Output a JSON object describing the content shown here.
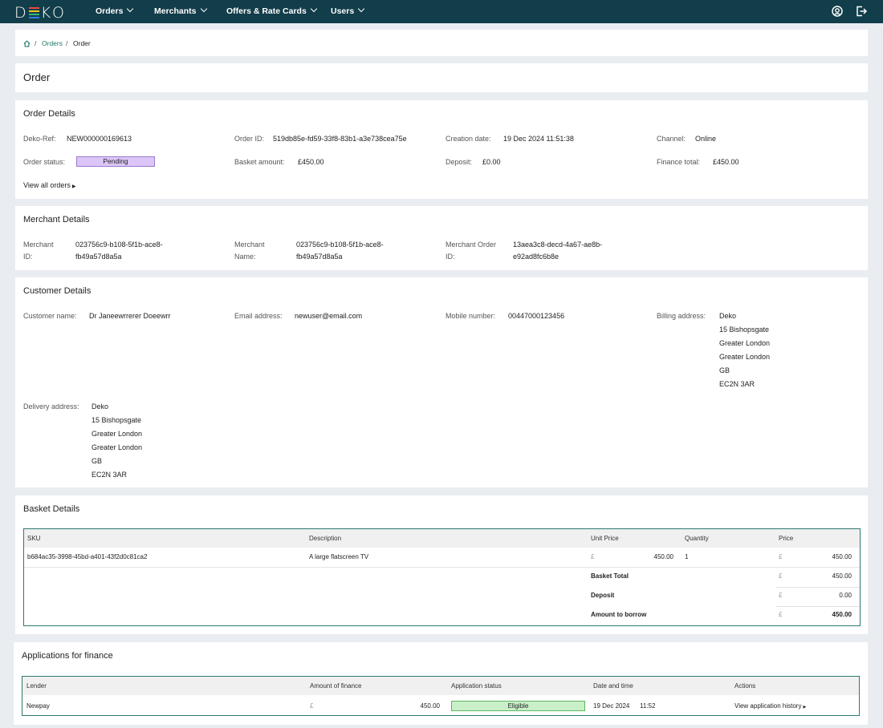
{
  "topbar": {
    "logo": "DEKO",
    "nav": [
      "Orders",
      "Merchants",
      "Offers & Rate Cards",
      "Users"
    ]
  },
  "breadcrumb": {
    "orders": "Orders",
    "current": "Order"
  },
  "page_title": "Order",
  "order_details": {
    "title": "Order Details",
    "deko_ref_label": "Deko-Ref:",
    "deko_ref": "NEW000000169613",
    "order_id_label": "Order ID:",
    "order_id": "519db85e-fd59-33f8-83b1-a3e738cea75e",
    "creation_label": "Creation date:",
    "creation": "19 Dec 2024 11:51:38",
    "channel_label": "Channel:",
    "channel": "Online",
    "status_label": "Order status:",
    "status": "Pending",
    "basket_label": "Basket amount:",
    "basket": "£450.00",
    "deposit_label": "Deposit:",
    "deposit": "£0.00",
    "finance_label": "Finance total:",
    "finance": "£450.00",
    "view_all": "View all orders"
  },
  "merchant_details": {
    "title": "Merchant Details",
    "id_label_1": "Merchant",
    "id_label_2": "ID:",
    "id_1": "023756c9-b108-5f1b-ace8-",
    "id_2": "fb49a57d8a5a",
    "name_label_1": "Merchant",
    "name_label_2": "Name:",
    "name_1": "023756c9-b108-5f1b-ace8-",
    "name_2": "fb49a57d8a5a",
    "order_label_1": "Merchant Order",
    "order_label_2": "ID:",
    "order_1": "13aea3c8-decd-4a67-ae8b-",
    "order_2": "e92ad8fc6b8e"
  },
  "customer_details": {
    "title": "Customer Details",
    "name_label": "Customer name:",
    "name": "Dr Janeewrrerer Doeewrr",
    "email_label": "Email address:",
    "email": "newuser@email.com",
    "mobile_label": "Mobile number:",
    "mobile": "00447000123456",
    "billing_label": "Billing address:",
    "billing": [
      "Deko",
      "15 Bishopsgate",
      "Greater London",
      "Greater London",
      "GB",
      "EC2N 3AR"
    ],
    "delivery_label": "Delivery address:",
    "delivery": [
      "Deko",
      "15 Bishopsgate",
      "Greater London",
      "Greater London",
      "GB",
      "EC2N 3AR"
    ]
  },
  "basket_details": {
    "title": "Basket Details",
    "headers": [
      "SKU",
      "Description",
      "Unit Price",
      "Quantity",
      "Price"
    ],
    "row": {
      "sku": "b684ac35-3998-45bd-a401-43f2d0c81ca2",
      "description": "A large flatscreen TV",
      "currency": "£",
      "unit_price": "450.00",
      "quantity": "1",
      "price": "450.00"
    },
    "basket_total_label": "Basket Total",
    "basket_total": "450.00",
    "deposit_label": "Deposit",
    "deposit": "0.00",
    "borrow_label": "Amount to borrow",
    "borrow": "450.00"
  },
  "applications": {
    "title": "Applications for finance",
    "headers": [
      "Lender",
      "Amount of finance",
      "Application status",
      "Date and time",
      "Actions"
    ],
    "row": {
      "lender": "Newpay",
      "currency": "£",
      "amount": "450.00",
      "status": "Eligible",
      "date": "19 Dec 2024",
      "time": "11:52",
      "action": "View application history"
    }
  },
  "colors": {
    "topbar": "#123d4a",
    "link": "#1f7a6a",
    "pending": "#dcc6f7",
    "eligible": "#c9efc9",
    "table_border": "#2d7a70"
  }
}
